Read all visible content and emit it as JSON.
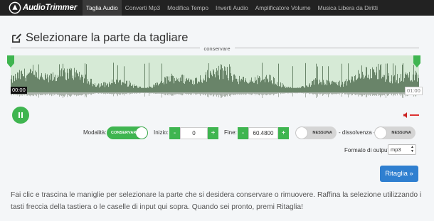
{
  "app": {
    "logo_text": "AudioTrimmer"
  },
  "nav": {
    "items": [
      {
        "label": "Taglia Audio",
        "active": true
      },
      {
        "label": "Converti Mp3",
        "active": false
      },
      {
        "label": "Modifica Tempo",
        "active": false
      },
      {
        "label": "Inverti Audio",
        "active": false
      },
      {
        "label": "Amplificatore Volume",
        "active": false
      },
      {
        "label": "Musica Libera da Diritti",
        "active": false
      }
    ]
  },
  "page": {
    "title": "Selezionare la parte da tagliare"
  },
  "waveform": {
    "zone_label": "conservare",
    "time_start": "00:00",
    "time_end": "01:00"
  },
  "player": {
    "play_icon": "pause-icon",
    "volume_icon": "speaker-icon"
  },
  "controls": {
    "mode_label": "Modalità:",
    "mode_value": "CONSERVARE",
    "start_label": "Inizio:",
    "start_value": "0",
    "end_label": "Fine:",
    "end_value": "60.4800",
    "minus": "-",
    "plus": "+",
    "fade_in_value": "NESSUNA",
    "fade_separator": "- dissolvenza -",
    "fade_out_value": "NESSUNA",
    "format_label": "Formato di output:",
    "format_value": "mp3",
    "submit_label": "Ritaglia »"
  },
  "info": {
    "text": "Fai clic e trascina le maniglie per selezionare la parte che si desidera conservare o rimuovere. Raffina la selezione utilizzando i tasti freccia della tastiera o le caselle di input qui sopra. Quando sei pronto, premi Ritaglia!"
  },
  "colors": {
    "navbar": "#222222",
    "accent_green": "#3fb550",
    "wave_bg": "#d6ead6",
    "wave_fill": "#4e6b4e",
    "button_blue": "#2f7fd0"
  }
}
